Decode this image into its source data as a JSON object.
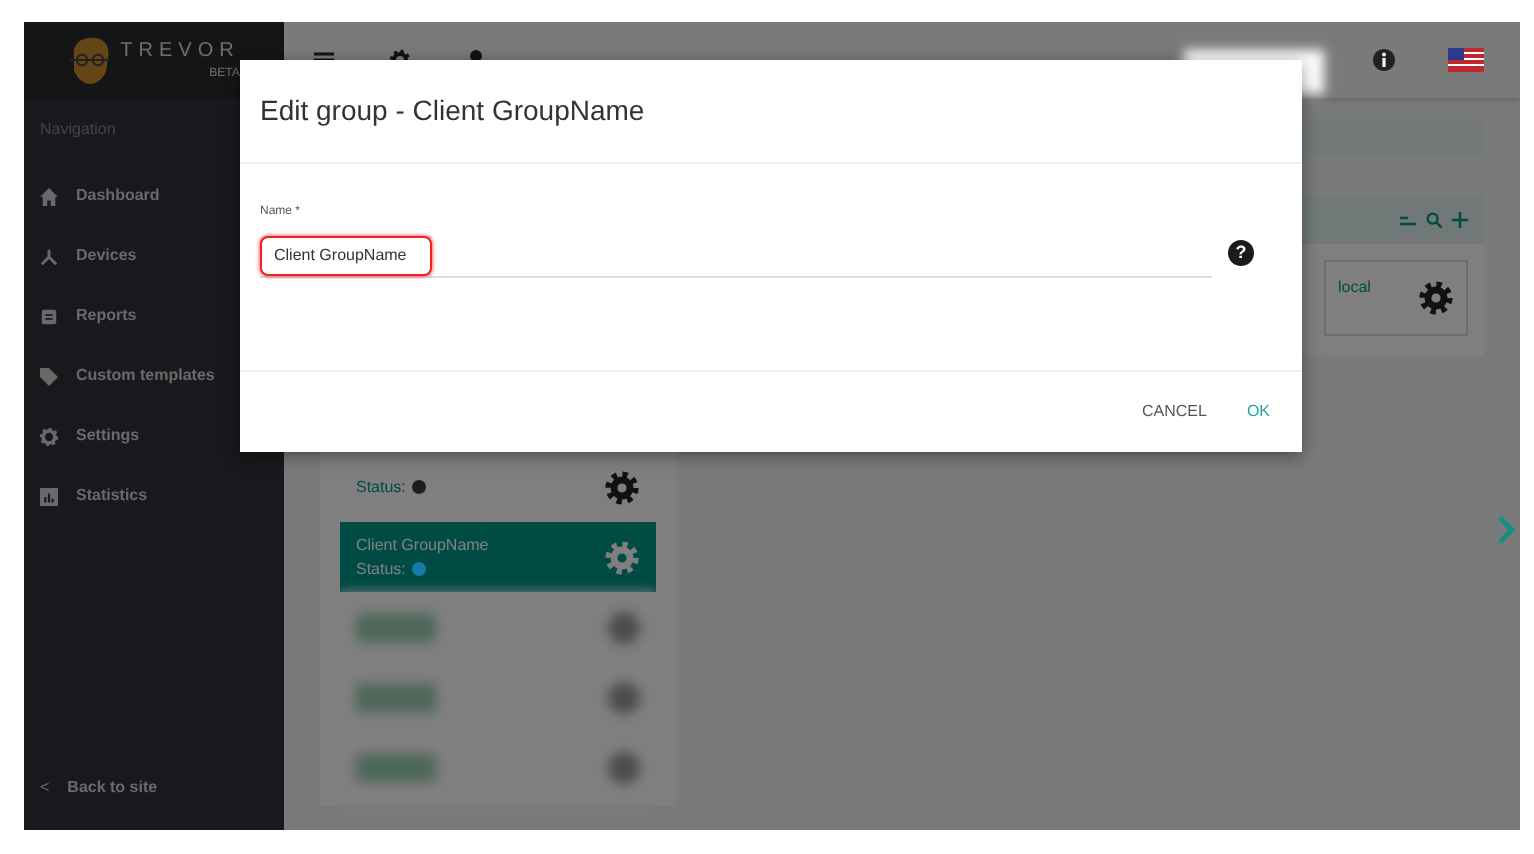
{
  "sidebar": {
    "logo": {
      "name": "TREVOR",
      "tag": "BETA"
    },
    "section": "Navigation",
    "items": [
      {
        "label": "Dashboard",
        "kind": "home"
      },
      {
        "label": "Devices",
        "kind": "fork"
      },
      {
        "label": "Reports",
        "kind": "report"
      },
      {
        "label": "Custom templates",
        "kind": "tag"
      },
      {
        "label": "Settings",
        "kind": "gear"
      },
      {
        "label": "Statistics",
        "kind": "chart"
      }
    ],
    "back": {
      "glyph": "<",
      "label": "Back to site"
    }
  },
  "device_card": {
    "name": "local"
  },
  "groups": [
    {
      "status": "Status:",
      "color": "#1e1e1e",
      "selected": false
    },
    {
      "name": "Client GroupName",
      "status": "Status:",
      "color": "#147ca6",
      "selected": true
    }
  ],
  "dialog": {
    "title": "Edit group - Client GroupName",
    "field": {
      "label": "Name *",
      "value": "Client GroupName",
      "help": "?"
    },
    "buttons": [
      {
        "label": "CANCEL",
        "kind": "secondary"
      },
      {
        "label": "OK",
        "kind": "primary"
      }
    ]
  }
}
